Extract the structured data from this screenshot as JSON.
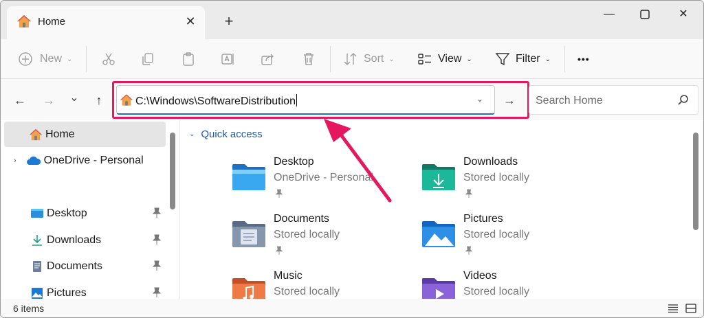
{
  "tab": {
    "title": "Home",
    "close": "✕",
    "new_tab": "+"
  },
  "window_controls": {
    "minimize": "—",
    "maximize": "☐",
    "close": "✕"
  },
  "toolbar": {
    "new_label": "New",
    "sort_label": "Sort",
    "view_label": "View",
    "filter_label": "Filter",
    "more_label": "•••"
  },
  "nav": {
    "back": "←",
    "forward": "→",
    "recent": "⌄",
    "up": "↑"
  },
  "address": {
    "value": "C:\\Windows\\SoftwareDistribution",
    "go": "→"
  },
  "search": {
    "placeholder": "Search Home"
  },
  "sidebar": {
    "items": [
      {
        "label": "Home"
      },
      {
        "label": "OneDrive - Personal"
      },
      {
        "label": "Desktop"
      },
      {
        "label": "Downloads"
      },
      {
        "label": "Documents"
      },
      {
        "label": "Pictures"
      }
    ]
  },
  "main": {
    "section_title": "Quick access",
    "tiles": [
      {
        "name": "Desktop",
        "sub": "OneDrive - Personal"
      },
      {
        "name": "Downloads",
        "sub": "Stored locally"
      },
      {
        "name": "Documents",
        "sub": "Stored locally"
      },
      {
        "name": "Pictures",
        "sub": "Stored locally"
      },
      {
        "name": "Music",
        "sub": "Stored locally"
      },
      {
        "name": "Videos",
        "sub": "Stored locally"
      }
    ]
  },
  "status": {
    "item_count": "6 items"
  },
  "colors": {
    "highlight": "#e4175f",
    "accent": "#1f6fc5",
    "section": "#1e5aa8"
  }
}
